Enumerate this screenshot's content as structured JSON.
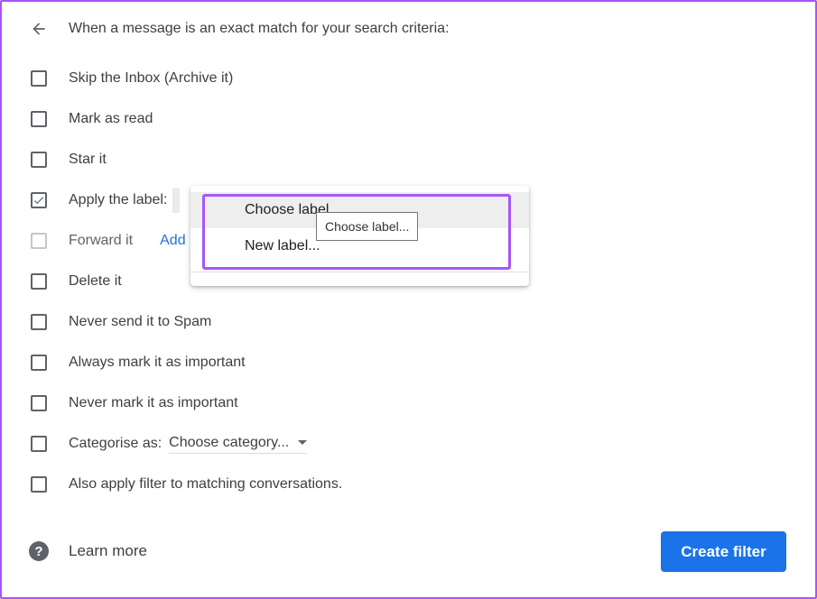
{
  "header": {
    "back_icon": "arrow-back-icon",
    "title": "When a message is an exact match for your search criteria:"
  },
  "options": [
    {
      "label": "Skip the Inbox (Archive it)",
      "checked": false
    },
    {
      "label": "Mark as read",
      "checked": false
    },
    {
      "label": "Star it",
      "checked": false
    },
    {
      "label": "Apply the label:",
      "checked": true
    },
    {
      "label": "Forward it",
      "checked": false,
      "disabled": true,
      "link": "Add"
    },
    {
      "label": "Delete it",
      "checked": false
    },
    {
      "label": "Never send it to Spam",
      "checked": false
    },
    {
      "label": "Always mark it as important",
      "checked": false
    },
    {
      "label": "Never mark it as important",
      "checked": false
    },
    {
      "label": "Categorise as:",
      "checked": false,
      "select": "Choose category..."
    },
    {
      "label": "Also apply filter to matching conversations.",
      "checked": false
    }
  ],
  "label_menu": {
    "items": [
      "Choose label...",
      "New label..."
    ],
    "tooltip": "Choose label..."
  },
  "footer": {
    "help_icon": "help-icon",
    "learn_more": "Learn more",
    "create_filter": "Create filter"
  },
  "colors": {
    "accent": "#1a73e8",
    "highlight": "#a855f7"
  }
}
